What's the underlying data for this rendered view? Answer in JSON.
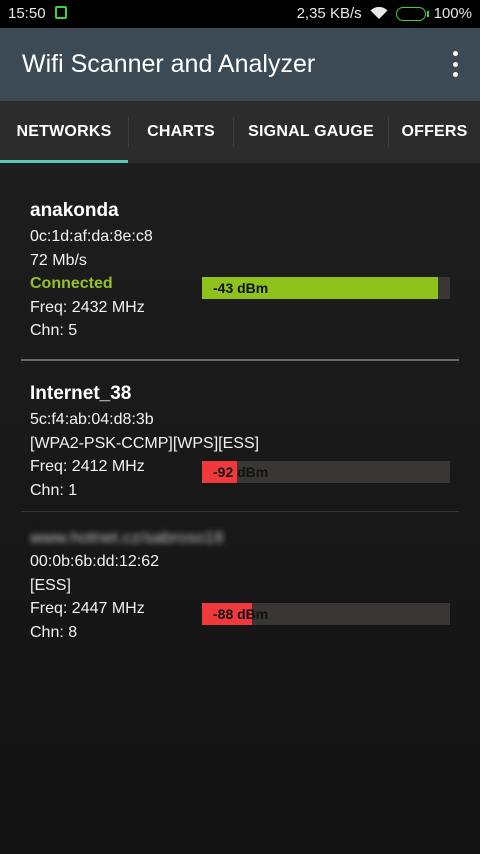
{
  "status_bar": {
    "time": "15:50",
    "speed": "2,35 KB/s",
    "battery": "100%"
  },
  "app_bar": {
    "title": "Wifi Scanner and Analyzer",
    "menu_icon": "more-vert-icon"
  },
  "tabs": [
    {
      "label": "NETWORKS",
      "active": true
    },
    {
      "label": "CHARTS",
      "active": false
    },
    {
      "label": "SIGNAL GAUGE",
      "active": false
    },
    {
      "label": "OFFERS",
      "active": false
    }
  ],
  "networks": [
    {
      "ssid": "anakonda",
      "bssid": "0c:1d:af:da:8e:c8",
      "info": "72 Mb/s",
      "status": "Connected",
      "freq": "Freq: 2432 MHz",
      "chn": "Chn: 5",
      "signal": "-43 dBm",
      "signal_level": 0.95,
      "signal_color": "#8fc21a"
    },
    {
      "ssid": "Internet_38",
      "bssid": "5c:f4:ab:04:d8:3b",
      "info": "[WPA2-PSK-CCMP][WPS][ESS]",
      "freq": "Freq: 2412 MHz",
      "chn": "Chn: 1",
      "signal": "-92 dBm",
      "signal_level": 0.14,
      "signal_color": "#f0393c"
    },
    {
      "ssid": "www.hotnet.cz/sabroso18",
      "bssid": "00:0b:6b:dd:12:62",
      "info": "[ESS]",
      "freq": "Freq: 2447 MHz",
      "chn": "Chn: 8",
      "signal": "-88 dBm",
      "signal_level": 0.2,
      "signal_color": "#f0393c"
    }
  ]
}
